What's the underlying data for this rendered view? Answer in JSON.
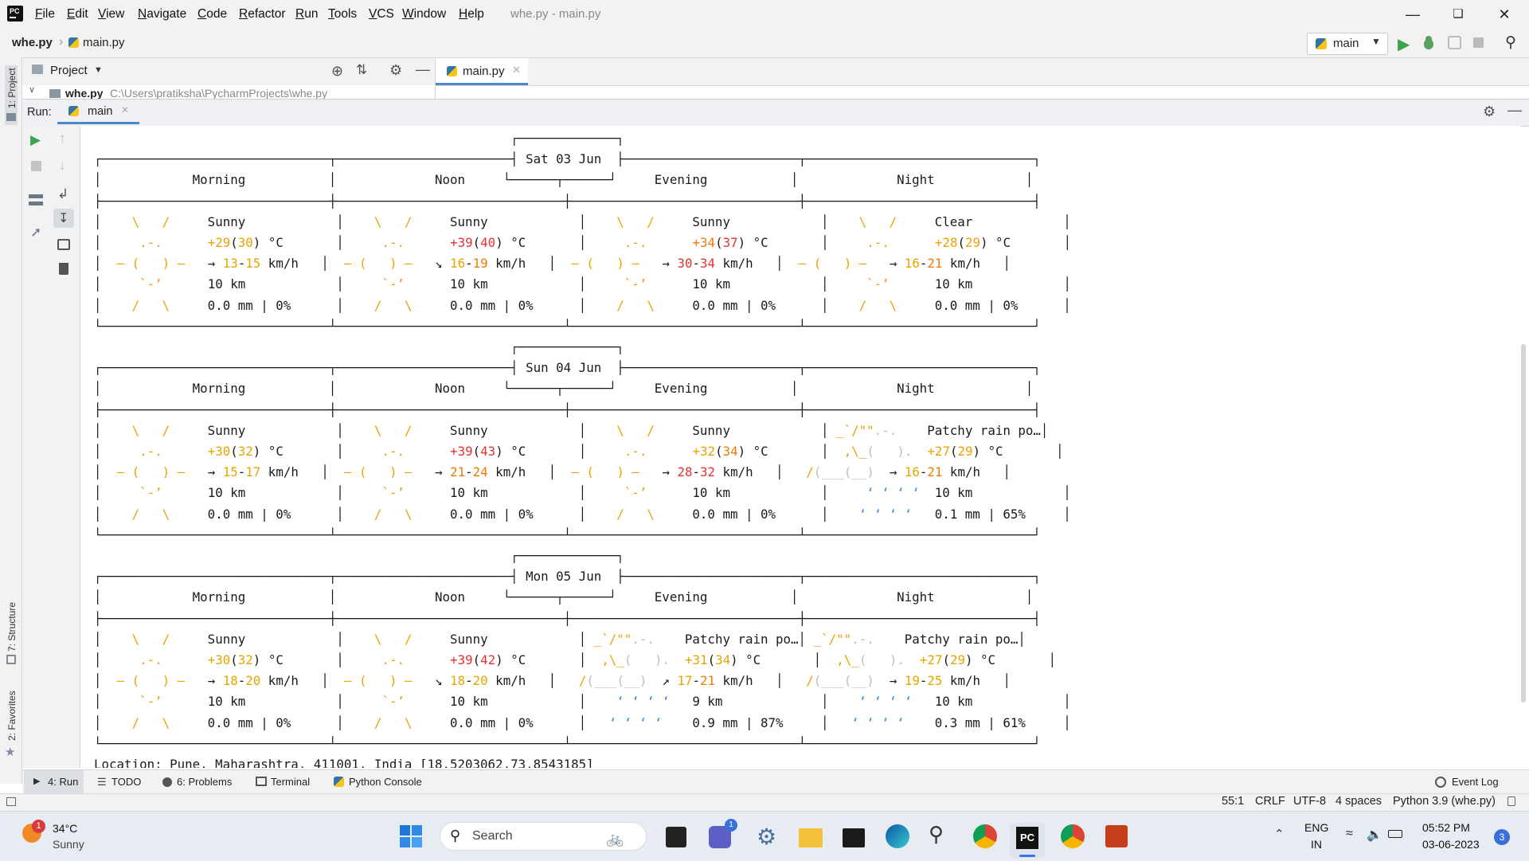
{
  "titlebar": {
    "menu": [
      "File",
      "Edit",
      "View",
      "Navigate",
      "Code",
      "Refactor",
      "Run",
      "Tools",
      "VCS",
      "Window",
      "Help"
    ],
    "window_title": "whe.py - main.py"
  },
  "breadcrumb": {
    "project": "whe.py",
    "file": "main.py"
  },
  "run_config": {
    "label": "main"
  },
  "left_stripe": {
    "project": "1: Project",
    "structure": "7: Structure",
    "favorites": "2: Favorites"
  },
  "project_panel": {
    "title": "Project",
    "root": "whe.py",
    "root_path": "C:\\Users\\pratiksha\\PycharmProjects\\whe.py"
  },
  "editor_tab": {
    "label": "main.py"
  },
  "run_panel": {
    "label": "Run:",
    "tab": "main"
  },
  "console": {
    "days": [
      {
        "date": "Sat 03 Jun"
      },
      {
        "date": "Sun 04 Jun"
      },
      {
        "date": "Mon 05 Jun"
      }
    ],
    "periods": [
      "Morning",
      "Noon",
      "Evening",
      "Night"
    ],
    "location": "Location: Pune, Maharashtra, 411001, India [18.5203062,73.8543185]"
  },
  "tool_tabs": [
    "4: Run",
    "TODO",
    "6: Problems",
    "Terminal",
    "Python Console"
  ],
  "event_log": "Event Log",
  "status": {
    "position": "55:1",
    "line_sep": "CRLF",
    "encoding": "UTF-8",
    "indent": "4 spaces",
    "interpreter": "Python 3.9 (whe.py)"
  },
  "taskbar": {
    "weather_temp": "34°C",
    "weather_desc": "Sunny",
    "weather_badge": "1",
    "search_placeholder": "Search",
    "lang": "ENG",
    "region": "IN",
    "time": "05:52 PM",
    "date": "03-06-2023",
    "notif_count": "3"
  },
  "colors": {
    "accent": "#3574f0",
    "sun": "#e8a400",
    "hot": "#e83232",
    "warm": "#f07a00",
    "rain": "#3d8ce0"
  }
}
